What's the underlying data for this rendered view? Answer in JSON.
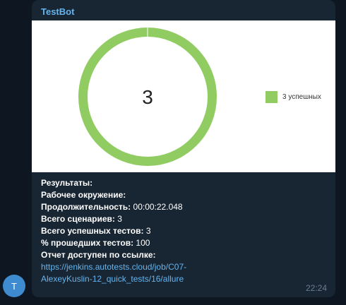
{
  "chat": {
    "avatar_letter": "T",
    "sender": "TestBot",
    "time": "22:24"
  },
  "chart_data": {
    "type": "pie",
    "center_label": "3",
    "slices": [
      {
        "name": "3 успешных",
        "value": 3,
        "color": "#91cc63"
      }
    ],
    "legend": "right"
  },
  "message": {
    "results_label": "Результаты:",
    "env_label": "Рабочее окружение:",
    "duration_label": "Продолжительность:",
    "duration_value": " 00:00:22.048",
    "scenarios_label": "Всего сценариев:",
    "scenarios_value": " 3",
    "passed_label": "Всего успешных тестов:",
    "passed_value": " 3",
    "percent_label": "% прошедших тестов:",
    "percent_value": " 100",
    "report_label": "Отчет доступен по ссылке:",
    "report_link": "https://jenkins.autotests.cloud/job/C07-AlexeyKuslin-12_quick_tests/16/allure",
    "report_link_line1": "https://jenkins.autotests.cloud/job/C07-",
    "report_link_line2": "AlexeyKuslin-12_quick_tests/16/allure"
  }
}
